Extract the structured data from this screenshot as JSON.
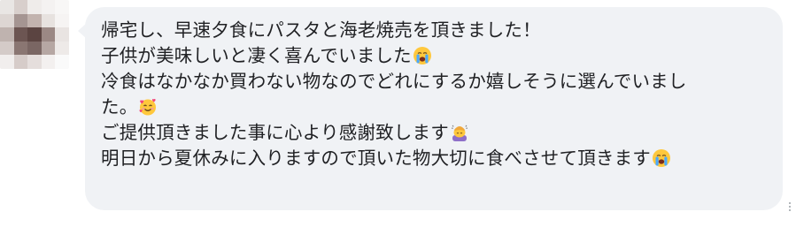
{
  "message": {
    "lines": [
      "帰宅し、早速夕食にパスタと海老焼売を頂きました！",
      "子供が美味しいと凄く喜んでいました",
      "冷食はなかなか買わない物なのでどれにするか嬉しそうに選んでいまし",
      "た。",
      "ご提供頂きました事に心より感謝致します",
      "明日から夏休みに入りますので頂いた物大切に食べさせて頂きます"
    ],
    "emojis": {
      "line2": "crying-face-icon",
      "line4": "smiling-face-with-hearts-icon",
      "line5": "person-bowing-icon",
      "line6": "crying-face-icon"
    }
  },
  "colors": {
    "bubble_bg": "#f0f2f5",
    "text": "#202124",
    "emoji_yellow": "#ffc83d",
    "tears_blue": "#4aa8ff",
    "heart_pink": "#f2457a"
  }
}
